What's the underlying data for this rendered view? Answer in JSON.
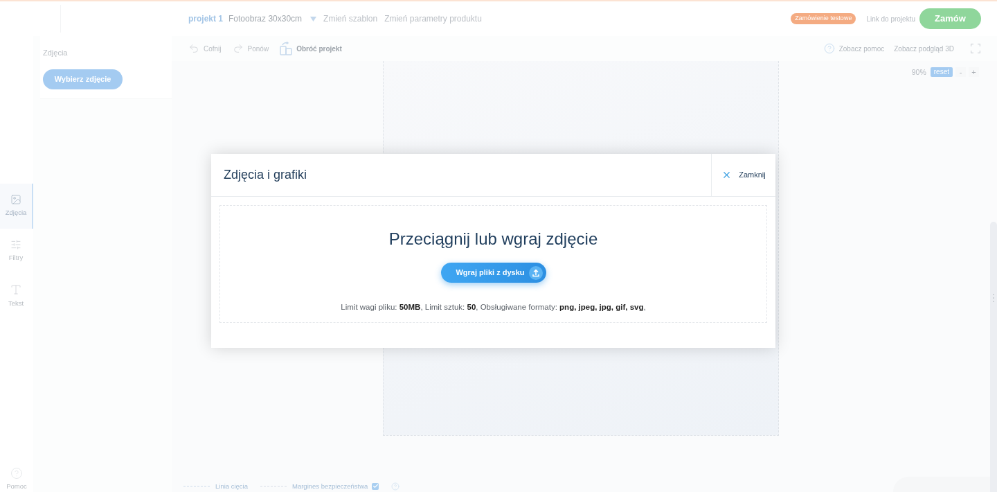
{
  "header": {
    "project_name": "projekt 1",
    "product": "Fotoobraz 30x30cm",
    "links": [
      "Zmień szablon",
      "Zmień parametry produktu"
    ],
    "badge": "Zamówienie testowe",
    "project_link": "Link do projektu",
    "order_button": "Zamów"
  },
  "rail": {
    "items": [
      {
        "label": "Zdjęcia",
        "selected": true
      },
      {
        "label": "Filtry",
        "selected": false
      },
      {
        "label": "Tekst",
        "selected": false
      }
    ],
    "help": "Pomoc"
  },
  "panel": {
    "title": "Zdjęcia",
    "button": "Wybierz zdjęcie"
  },
  "toolbar": {
    "actions": [
      {
        "label": "Cofnij",
        "disabled": true
      },
      {
        "label": "Ponów",
        "disabled": true
      },
      {
        "label": "Obróć projekt",
        "disabled": false
      }
    ],
    "right": [
      "Zobacz pomoc",
      "Zobacz podgląd 3D"
    ]
  },
  "zoom": {
    "value": "90%",
    "reset": "reset",
    "minus": "-",
    "plus": "+"
  },
  "legend": {
    "cut_line": "Linia cięcia",
    "safety_margin": "Margines bezpieczeństwa",
    "safety_margin_shown": true
  },
  "modal": {
    "title": "Zdjęcia i grafiki",
    "close": "Zamknij",
    "drop_heading": "Przeciągnij lub wgraj zdjęcie",
    "upload_button": "Wgraj pliki z dysku",
    "limits": "Limit wagi pliku: **50MB**, Limit sztuk: **50**, Obsługiwane formaty: **png, jpeg, jpg, gif, svg**,"
  }
}
